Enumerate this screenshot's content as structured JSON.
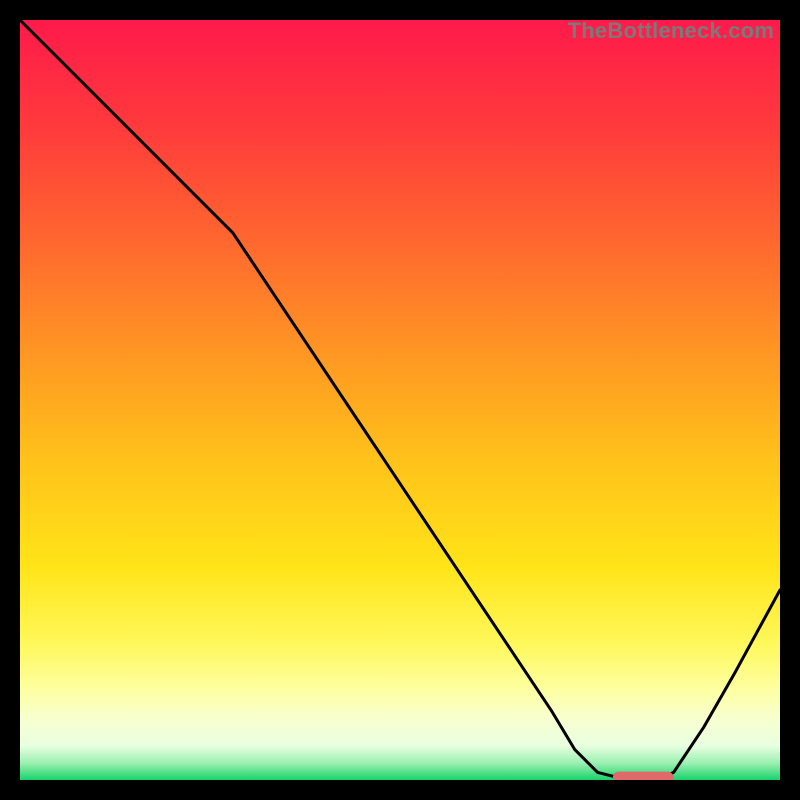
{
  "watermark": "TheBottleneck.com",
  "chart_data": {
    "type": "line",
    "title": "",
    "xlabel": "",
    "ylabel": "",
    "xlim": [
      0,
      100
    ],
    "ylim": [
      0,
      100
    ],
    "grid": false,
    "legend": false,
    "gradient_stops": [
      {
        "offset": 0.0,
        "color": "#ff1a4b"
      },
      {
        "offset": 0.14,
        "color": "#ff3a3c"
      },
      {
        "offset": 0.3,
        "color": "#ff6a2e"
      },
      {
        "offset": 0.45,
        "color": "#ff9a22"
      },
      {
        "offset": 0.58,
        "color": "#ffc21a"
      },
      {
        "offset": 0.72,
        "color": "#ffe418"
      },
      {
        "offset": 0.82,
        "color": "#fff85a"
      },
      {
        "offset": 0.88,
        "color": "#fdffa0"
      },
      {
        "offset": 0.92,
        "color": "#f8ffd0"
      },
      {
        "offset": 0.955,
        "color": "#e8ffe0"
      },
      {
        "offset": 0.978,
        "color": "#9af0b0"
      },
      {
        "offset": 1.0,
        "color": "#17d36a"
      }
    ],
    "series": [
      {
        "name": "curve",
        "color": "#000000",
        "width": 3,
        "x": [
          0,
          6,
          12,
          18,
          24,
          28,
          34,
          40,
          46,
          52,
          58,
          64,
          70,
          73,
          76,
          80,
          84,
          86,
          90,
          94,
          100
        ],
        "y": [
          100,
          94,
          88,
          82,
          76,
          72,
          63,
          54,
          45,
          36,
          27,
          18,
          9,
          4,
          1,
          0,
          0,
          1,
          7,
          14,
          25
        ]
      }
    ],
    "marker": {
      "name": "optimal-band",
      "color": "#e06a6a",
      "x_start": 78,
      "x_end": 86,
      "y": 0.3,
      "thickness": 1.6
    }
  }
}
